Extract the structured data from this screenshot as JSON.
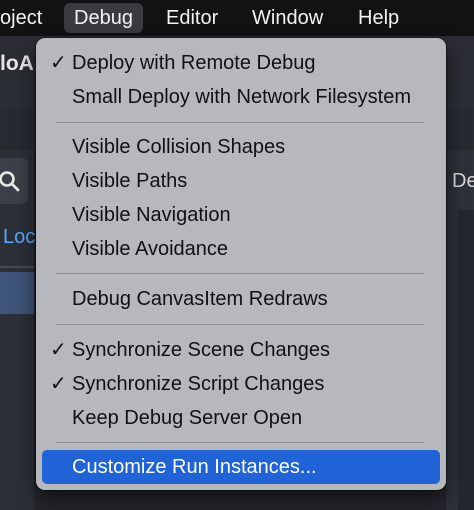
{
  "menubar": {
    "items": [
      "oject",
      "Debug",
      "Editor",
      "Window",
      "Help"
    ],
    "active_index": 1
  },
  "background": {
    "title_fragment": "loA",
    "left_link_fragment": "Loc",
    "right_tab_fragment": "De"
  },
  "debug_menu": {
    "items": [
      {
        "label": "Deploy with Remote Debug",
        "checked": true,
        "check_glyph": "✓"
      },
      {
        "label": "Small Deploy with Network Filesystem",
        "checked": false,
        "check_glyph": ""
      },
      {
        "label": "Visible Collision Shapes",
        "checked": false,
        "check_glyph": ""
      },
      {
        "label": "Visible Paths",
        "checked": false,
        "check_glyph": ""
      },
      {
        "label": "Visible Navigation",
        "checked": false,
        "check_glyph": ""
      },
      {
        "label": "Visible Avoidance",
        "checked": false,
        "check_glyph": ""
      },
      {
        "label": "Debug CanvasItem Redraws",
        "checked": false,
        "check_glyph": ""
      },
      {
        "label": "Synchronize Scene Changes",
        "checked": true,
        "check_glyph": "✓"
      },
      {
        "label": "Synchronize Script Changes",
        "checked": true,
        "check_glyph": "✓"
      },
      {
        "label": "Keep Debug Server Open",
        "checked": false,
        "check_glyph": ""
      },
      {
        "label": "Customize Run Instances...",
        "checked": false,
        "check_glyph": "",
        "highlighted": true
      }
    ]
  },
  "colors": {
    "highlight": "#1f63d6",
    "link": "#5aa7ff",
    "menu_background": "#b6b8bb"
  },
  "icons": {
    "search": "search-icon",
    "check": "checkmark-icon"
  }
}
